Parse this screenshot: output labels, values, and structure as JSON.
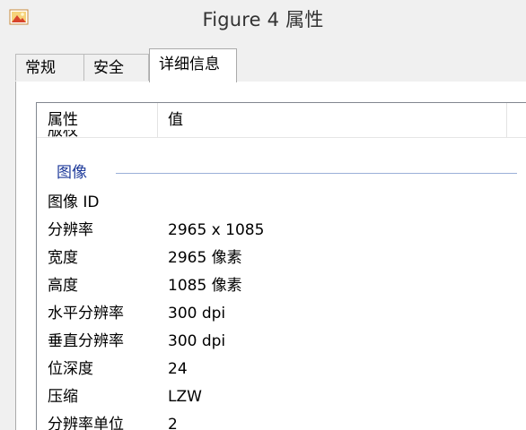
{
  "window": {
    "title": "Figure 4 属性",
    "icon": "image-file-icon"
  },
  "tabs": [
    {
      "label": "常规",
      "active": false
    },
    {
      "label": "安全",
      "active": false
    },
    {
      "label": "详细信息",
      "active": true
    }
  ],
  "list": {
    "columns": {
      "property": "属性",
      "value": "值"
    },
    "clipped_row": {
      "name": "版权"
    },
    "group_label": "图像",
    "rows": [
      {
        "name": "图像 ID",
        "value": ""
      },
      {
        "name": "分辨率",
        "value": "2965 x 1085"
      },
      {
        "name": "宽度",
        "value": "2965 像素"
      },
      {
        "name": "高度",
        "value": "1085 像素"
      },
      {
        "name": "水平分辨率",
        "value": "300 dpi"
      },
      {
        "name": "垂直分辨率",
        "value": "300 dpi"
      },
      {
        "name": "位深度",
        "value": "24"
      },
      {
        "name": "压缩",
        "value": "LZW"
      },
      {
        "name": "分辨率单位",
        "value": "2"
      }
    ]
  }
}
